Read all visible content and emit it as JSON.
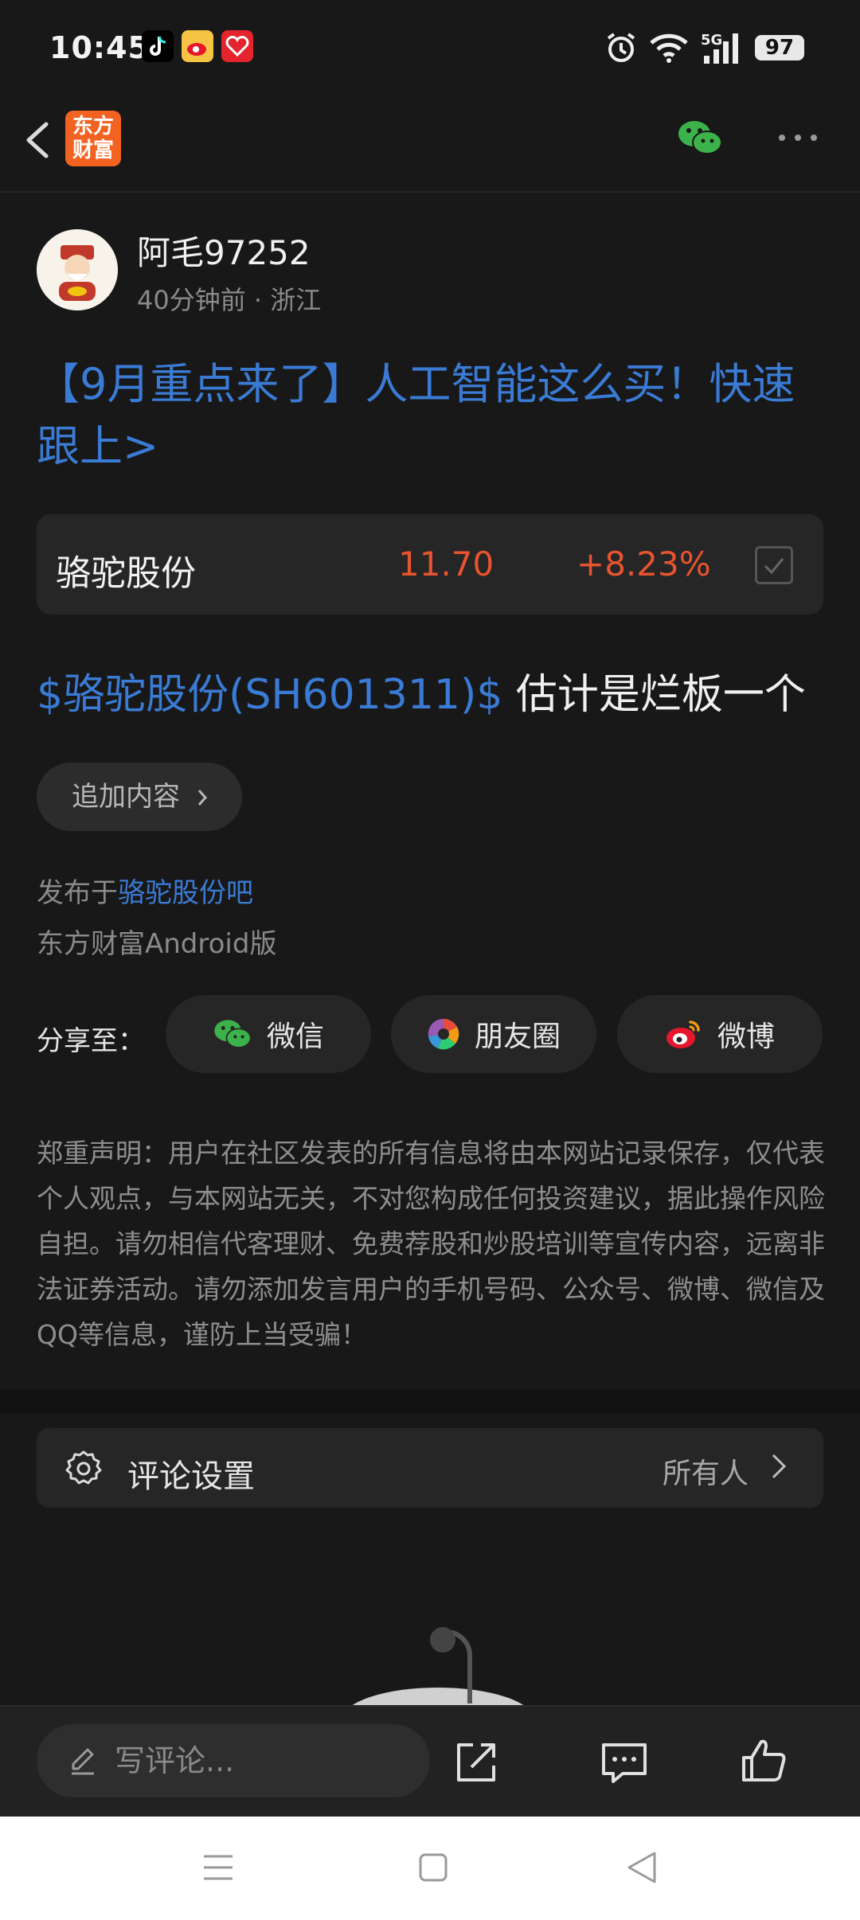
{
  "status_bar": {
    "time": "10:45",
    "network": "5G",
    "battery": "97",
    "app_icons": [
      "tiktok-icon",
      "weibo-app-icon",
      "heart-app-icon"
    ]
  },
  "header": {
    "logo_line1": "东方",
    "logo_line2": "财富"
  },
  "post": {
    "username": "阿毛97252",
    "meta": "40分钟前 · 浙江",
    "title": "【9月重点来了】人工智能这么买！快速跟上>",
    "stock": {
      "name": "骆驼股份",
      "price": "11.70",
      "change": "+8.23%"
    },
    "body_link": "$骆驼股份(SH601311)$",
    "body_text": " 估计是烂板一个",
    "add_more": "追加内容",
    "published_prefix": "发布于",
    "published_link": "骆驼股份吧",
    "platform": "东方财富Android版"
  },
  "share": {
    "label": "分享至：",
    "buttons": [
      "微信",
      "朋友圈",
      "微博"
    ]
  },
  "disclaimer": "郑重声明：用户在社区发表的所有信息将由本网站记录保存，仅代表个人观点，与本网站无关，不对您构成任何投资建议，据此操作风险自担。请勿相信代客理财、免费荐股和炒股培训等宣传内容，远离非法证券活动。请勿添加发言用户的手机号码、公众号、微博、微信及QQ等信息，谨防上当受骗！",
  "comment_settings": {
    "label": "评论设置",
    "value": "所有人"
  },
  "bottom_bar": {
    "comment_placeholder": "写评论..."
  },
  "colors": {
    "link": "#3a7bd5",
    "up": "#e8542f",
    "brand": "#f26322",
    "wechat": "#3cb34a"
  }
}
